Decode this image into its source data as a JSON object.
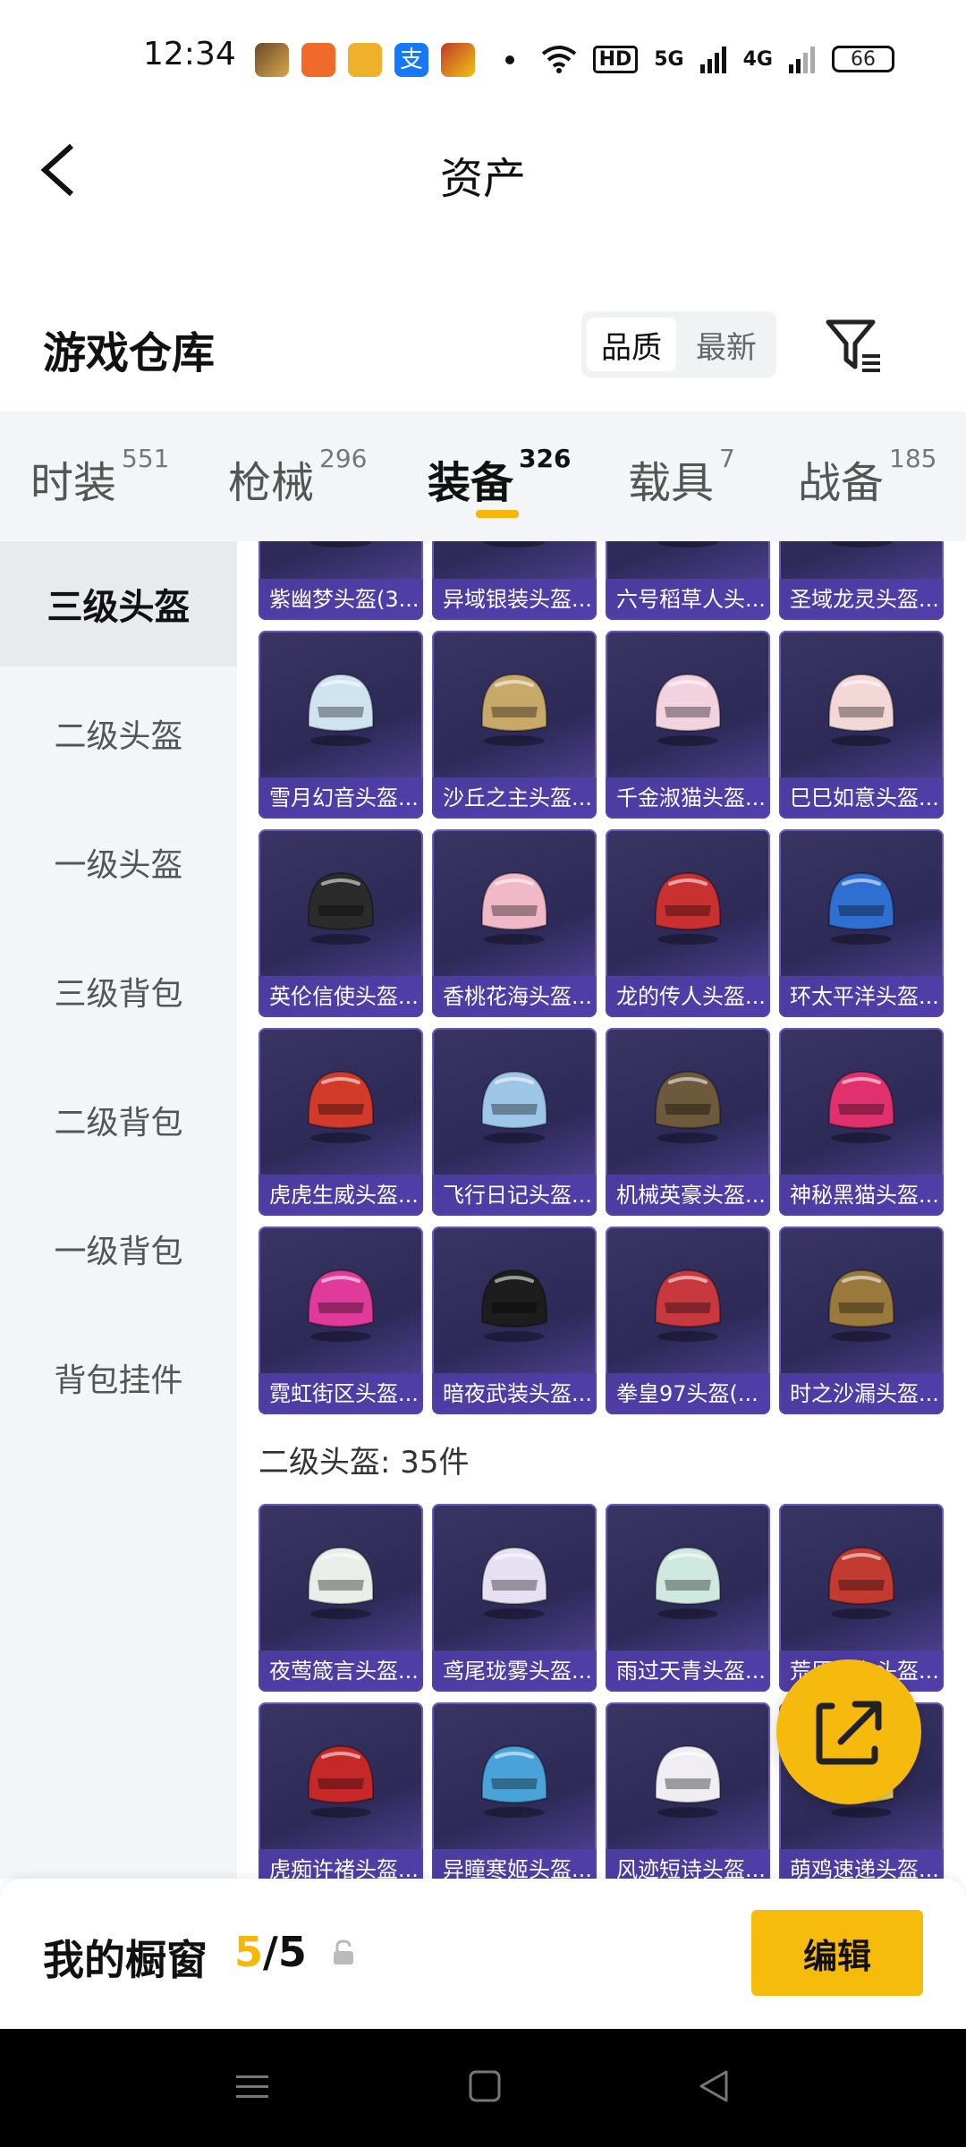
{
  "status_bar": {
    "time": "12:34",
    "signal_labels": [
      "HD",
      "5G",
      "4G"
    ],
    "battery": "66",
    "app_icons": [
      "game-app-icon",
      "cf-app-icon",
      "coin-app-icon",
      "alipay-icon",
      "game2-app-icon"
    ]
  },
  "header": {
    "title": "资产",
    "back_icon": "chevron-left-icon"
  },
  "warehouse": {
    "title": "游戏仓库",
    "sort_options": [
      "品质",
      "最新"
    ],
    "sort_selected": "品质",
    "filter_icon": "filter-icon"
  },
  "tabs": [
    {
      "label": "时装",
      "count": "551"
    },
    {
      "label": "枪械",
      "count": "296"
    },
    {
      "label": "装备",
      "count": "326"
    },
    {
      "label": "载具",
      "count": "7"
    },
    {
      "label": "战备",
      "count": "185"
    }
  ],
  "active_tab": "装备",
  "sidebar": [
    "三级头盔",
    "二级头盔",
    "一级头盔",
    "三级背包",
    "二级背包",
    "一级背包",
    "背包挂件"
  ],
  "active_sidebar": "三级头盔",
  "items_top": [
    {
      "name": "紫幽梦头盔(3...",
      "color": "#c8a24a"
    },
    {
      "name": "异域银装头盔...",
      "color": "#3c8d9a"
    },
    {
      "name": "六号稻草人头...",
      "color": "#c9862b"
    },
    {
      "name": "圣域龙灵头盔...",
      "color": "#b5893a"
    },
    {
      "name": "雪月幻音头盔...",
      "color": "#cfe3f0"
    },
    {
      "name": "沙丘之主头盔...",
      "color": "#c9a96a"
    },
    {
      "name": "千金淑猫头盔...",
      "color": "#f3d2e0"
    },
    {
      "name": "巳巳如意头盔...",
      "color": "#f4d8d8"
    },
    {
      "name": "英伦信使头盔...",
      "color": "#2b2b2b"
    },
    {
      "name": "香桃花海头盔...",
      "color": "#f1b8c8"
    },
    {
      "name": "龙的传人头盔...",
      "color": "#c93030"
    },
    {
      "name": "环太平洋头盔...",
      "color": "#2f6fd1"
    },
    {
      "name": "虎虎生威头盔...",
      "color": "#d23a2a"
    },
    {
      "name": "飞行日记头盔...",
      "color": "#9ec6e6"
    },
    {
      "name": "机械英豪头盔...",
      "color": "#6d5a3c"
    },
    {
      "name": "神秘黑猫头盔...",
      "color": "#e0306d"
    },
    {
      "name": "霓虹街区头盔...",
      "color": "#e03a9a"
    },
    {
      "name": "暗夜武装头盔...",
      "color": "#1d1d1d"
    },
    {
      "name": "拳皇97头盔(...",
      "color": "#c8383f"
    },
    {
      "name": "时之沙漏头盔...",
      "color": "#9a7a3c"
    }
  ],
  "section_label": "二级头盔: 35件",
  "items_bottom": [
    {
      "name": "夜莺箴言头盔...",
      "color": "#e8eee8"
    },
    {
      "name": "鸢尾珑雾头盔...",
      "color": "#e6e0f2"
    },
    {
      "name": "雨过天青头盔...",
      "color": "#cfe8e0"
    },
    {
      "name": "荒原霸主头盔...",
      "color": "#c33b30"
    },
    {
      "name": "虎痴许褚头盔...",
      "color": "#c62828"
    },
    {
      "name": "异瞳寒姬头盔...",
      "color": "#4aa3d8"
    },
    {
      "name": "风迹短诗头盔...",
      "color": "#f0eef2"
    },
    {
      "name": "萌鸡速递头盔...",
      "color": "#f1d36a"
    }
  ],
  "showcase": {
    "label": "我的橱窗",
    "current": "5",
    "separator": "/",
    "total": "5",
    "lock_icon": "lock-icon",
    "edit_label": "编辑"
  },
  "fab": {
    "icon": "share-out-icon"
  },
  "nav": [
    "menu-icon",
    "home-icon",
    "back-icon"
  ],
  "colors": {
    "accent": "#f5b80a",
    "card": "#2d2a58",
    "card_label": "#503eaa"
  }
}
